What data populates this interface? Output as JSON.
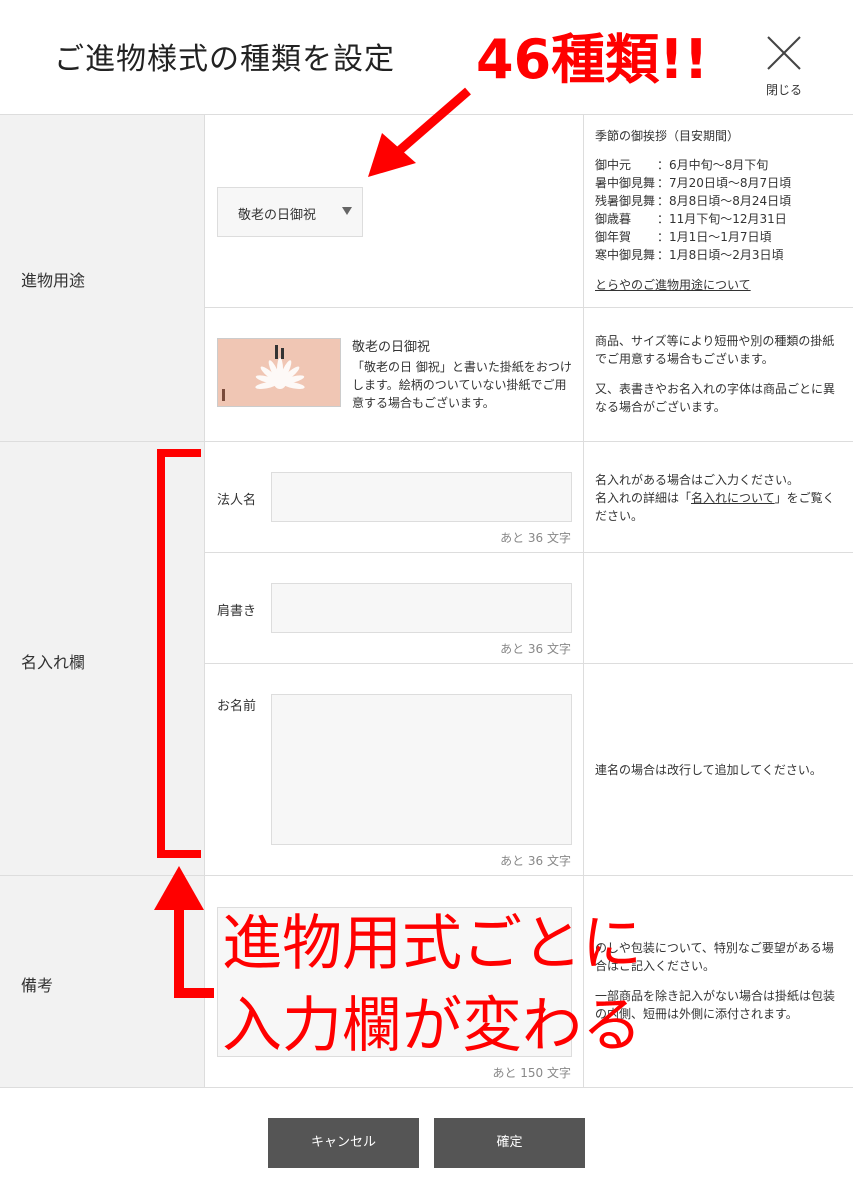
{
  "header": {
    "title": "ご進物様式の種類を設定",
    "close_label": "閉じる"
  },
  "purpose": {
    "label": "進物用途",
    "selected": "敬老の日御祝",
    "season_heading": "季節の御挨拶（目安期間）",
    "seasons": [
      {
        "name": "御中元",
        "period": "：6月中旬～8月下旬"
      },
      {
        "name": "暑中御見舞",
        "period": "：7月20日頃～8月7日頃"
      },
      {
        "name": "残暑御見舞",
        "period": "：8月8日頃～8月24日頃"
      },
      {
        "name": "御歳暮",
        "period": "：11月下旬～12月31日"
      },
      {
        "name": "御年賀",
        "period": "：1月1日～1月7日頃"
      },
      {
        "name": "寒中御見舞",
        "period": "：1月8日頃～2月3日頃"
      }
    ],
    "link": "とらやのご進物用途について",
    "noshi_title": "敬老の日御祝",
    "noshi_desc": "「敬老の日 御祝」と書いた掛紙をおつけします。絵柄のついていない掛紙でご用意する場合もございます。",
    "note1": "商品、サイズ等により短冊や別の種類の掛紙でご用意する場合もございます。",
    "note2": "又、表書きやお名入れの字体は商品ごとに異なる場合がございます。"
  },
  "nameplate": {
    "label": "名入れ欄",
    "fields": [
      {
        "label": "法人名",
        "count": "あと 36 文字"
      },
      {
        "label": "肩書き",
        "count": "あと 36 文字"
      },
      {
        "label": "お名前",
        "count": "あと 36 文字"
      }
    ],
    "note_line1": "名入れがある場合はご入力ください。",
    "note_line2_pre": "名入れの詳細は「",
    "note_link": "名入れについて",
    "note_line2_post": "」をご覧ください。",
    "note_multi": "連名の場合は改行して追加してください。"
  },
  "remarks": {
    "label": "備考",
    "count": "あと 150 文字",
    "note1": "のしや包装について、特別なご要望がある場合はご記入ください。",
    "note2": "一部商品を除き記入がない場合は掛紙は包装の内側、短冊は外側に添付されます。"
  },
  "footer": {
    "cancel": "キャンセル",
    "confirm": "確定"
  },
  "annotations": {
    "count_note": "46種類!!",
    "line1": "進物用式ごとに",
    "line2": "入力欄が変わる",
    "color": "#ff0000"
  }
}
